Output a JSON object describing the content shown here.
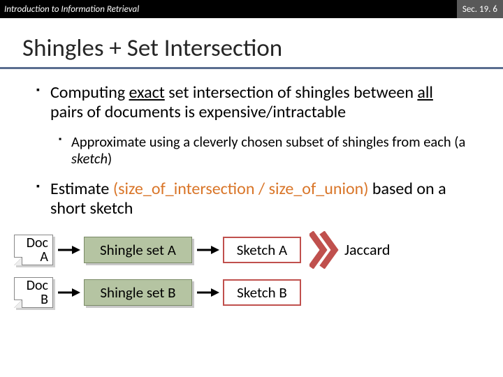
{
  "header": {
    "left": "Introduction to Information Retrieval",
    "right": "Sec. 19. 6"
  },
  "title": "Shingles + Set Intersection",
  "b1": {
    "pre": "Computing ",
    "u1": "exact",
    "mid": " set intersection of shingles between ",
    "u2": "all",
    "post": " pairs of documents is expensive/intractable"
  },
  "b2": {
    "pre": "Approximate using a cleverly chosen subset of shingles from each (a ",
    "em": "sketch",
    "post": ")"
  },
  "b3": {
    "pre": "Estimate ",
    "mid": "(size_of_intersection / size_of_union)",
    "post": " based on a short sketch"
  },
  "diagram": {
    "docA": {
      "l1": "Doc",
      "l2": "A"
    },
    "docB": {
      "l1": "Doc",
      "l2": "B"
    },
    "shingleA": "Shingle set A",
    "shingleB": "Shingle set B",
    "sketchA": "Sketch A",
    "sketchB": "Sketch B",
    "jaccard": "Jaccard"
  }
}
